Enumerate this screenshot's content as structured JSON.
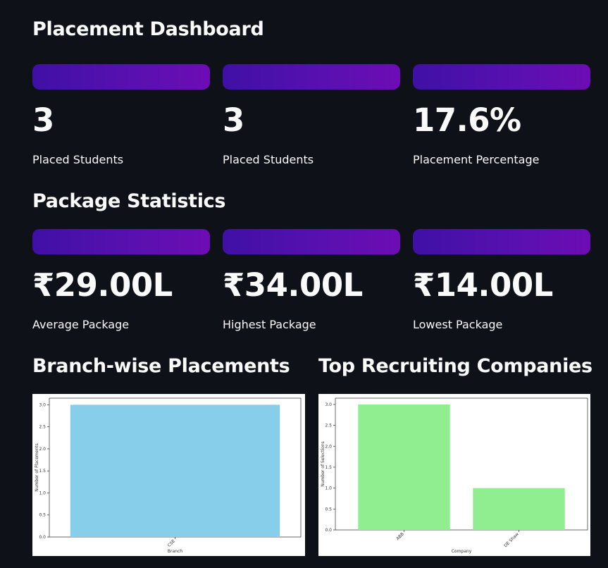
{
  "title": "Placement Dashboard",
  "top_metrics": [
    {
      "value": "3",
      "label": "Placed Students"
    },
    {
      "value": "3",
      "label": "Placed Students"
    },
    {
      "value": "17.6%",
      "label": "Placement Percentage"
    }
  ],
  "package_section": {
    "title": "Package Statistics",
    "metrics": [
      {
        "value": "₹29.00L",
        "label": "Average Package"
      },
      {
        "value": "₹34.00L",
        "label": "Highest Package"
      },
      {
        "value": "₹14.00L",
        "label": "Lowest Package"
      }
    ]
  },
  "branch_section": {
    "title": "Branch-wise Placements"
  },
  "companies_section": {
    "title": "Top Recruiting Companies"
  },
  "colors": {
    "accent_start": "#3f10a6",
    "accent_end": "#6d0cb4",
    "branch_bar": "#87ceeb",
    "company_bar": "#90ee90",
    "background": "#0e1117"
  },
  "chart_data": [
    {
      "type": "bar",
      "categories": [
        "CSE"
      ],
      "values": [
        3
      ],
      "title": "",
      "xlabel": "Branch",
      "ylabel": "Number of Placements",
      "ylim": [
        0,
        3.15
      ],
      "yticks": [
        "0.0",
        "0.5",
        "1.0",
        "1.5",
        "2.0",
        "2.5",
        "3.0"
      ],
      "color": "#87ceeb"
    },
    {
      "type": "bar",
      "categories": [
        "ABB",
        "DE Shaw"
      ],
      "values": [
        3,
        1
      ],
      "title": "",
      "xlabel": "Company",
      "ylabel": "Number of Selections",
      "ylim": [
        0,
        3.15
      ],
      "yticks": [
        "0.0",
        "0.5",
        "1.0",
        "1.5",
        "2.0",
        "2.5",
        "3.0"
      ],
      "color": "#90ee90"
    }
  ]
}
